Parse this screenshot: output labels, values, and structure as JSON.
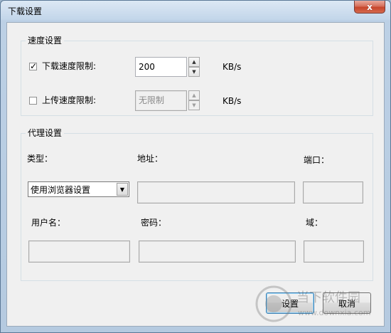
{
  "window": {
    "title": "下载设置",
    "close_glyph": "x"
  },
  "speed_group": {
    "title": "速度设置",
    "download": {
      "checked": true,
      "check_glyph": "✓",
      "label": "下载速度限制:",
      "value": "200",
      "unit": "KB/s"
    },
    "upload": {
      "checked": false,
      "label": "上传速度限制:",
      "value": "无限制",
      "unit": "KB/s"
    }
  },
  "proxy_group": {
    "title": "代理设置",
    "type_label": "类型：",
    "address_label": "地址：",
    "port_label": "端口：",
    "type_value": "使用浏览器设置",
    "username_label": "用户名：",
    "password_label": "密码：",
    "domain_label": "域："
  },
  "buttons": {
    "ok": "设置",
    "cancel": "取消"
  },
  "watermark": {
    "text": "当下软件园",
    "url": "www.downxia.com"
  },
  "colors": {
    "close_button": "#c7452b",
    "frame": "#b5cae0",
    "dialog_bg": "#f0f0f0"
  }
}
